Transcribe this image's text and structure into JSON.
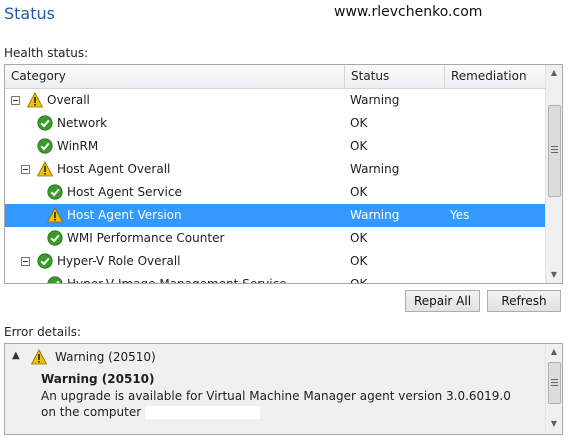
{
  "page": {
    "title": "Status",
    "watermark": "www.rlevchenko.com"
  },
  "health": {
    "label": "Health status:",
    "columns": {
      "category": "Category",
      "status": "Status",
      "remediation": "Remediation"
    },
    "rows": [
      {
        "category": "Overall",
        "status": "Warning",
        "remediation": "",
        "icon": "warning-icon",
        "level": 0,
        "expander": true
      },
      {
        "category": "Network",
        "status": "OK",
        "remediation": "",
        "icon": "ok-check-icon",
        "level": 1,
        "expander": false
      },
      {
        "category": "WinRM",
        "status": "OK",
        "remediation": "",
        "icon": "ok-check-icon",
        "level": 1,
        "expander": false
      },
      {
        "category": "Host Agent Overall",
        "status": "Warning",
        "remediation": "",
        "icon": "warning-icon",
        "level": 1,
        "expander": true
      },
      {
        "category": "Host Agent Service",
        "status": "OK",
        "remediation": "",
        "icon": "ok-check-icon",
        "level": 2,
        "expander": false
      },
      {
        "category": "Host Agent Version",
        "status": "Warning",
        "remediation": "Yes",
        "icon": "warning-icon",
        "level": 2,
        "expander": false,
        "selected": true
      },
      {
        "category": "WMI Performance Counter",
        "status": "OK",
        "remediation": "",
        "icon": "ok-check-icon",
        "level": 2,
        "expander": false
      },
      {
        "category": "Hyper-V Role Overall",
        "status": "OK",
        "remediation": "",
        "icon": "ok-check-icon",
        "level": 1,
        "expander": true
      },
      {
        "category": "Hyper-V Image Management Service",
        "status": "OK",
        "remediation": "",
        "icon": "ok-check-icon",
        "level": 2,
        "expander": false
      }
    ]
  },
  "buttons": {
    "repair_all": "Repair All",
    "refresh": "Refresh"
  },
  "error": {
    "label": "Error details:",
    "heading": "Warning (20510)",
    "bold_title": "Warning (20510)",
    "message": "An upgrade is available for Virtual Machine Manager agent version 3.0.6019.0 on the computer"
  },
  "colors": {
    "selection": "#3399ff",
    "title": "#1e5aa8",
    "ok": "#3a9a2a",
    "warning": "#f2c200"
  }
}
